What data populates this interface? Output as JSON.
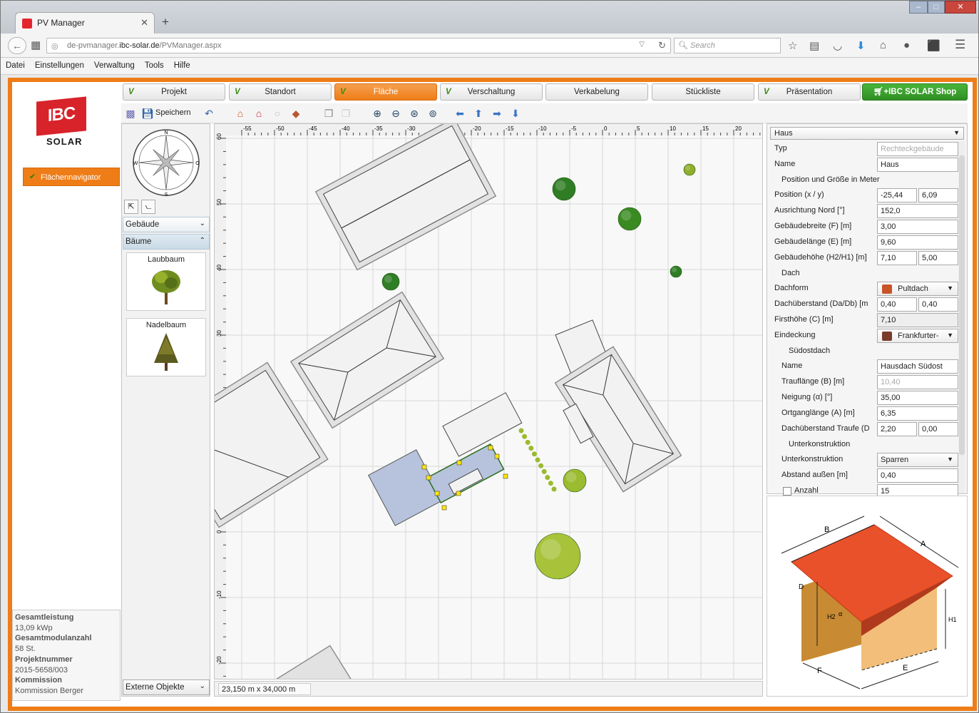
{
  "browser": {
    "tab_title": "PV Manager",
    "url_prefix": "de-pvmanager.",
    "url_domain": "ibc-solar.de",
    "url_path": "/PVManager.aspx",
    "search_placeholder": "Search"
  },
  "menu": [
    "Datei",
    "Einstellungen",
    "Verwaltung",
    "Tools",
    "Hilfe"
  ],
  "logo": {
    "top": "IBC",
    "bottom": "SOLAR"
  },
  "sidebar": {
    "navigator_label": "Flächennavigator"
  },
  "summary": {
    "total_power_label": "Gesamtleistung",
    "total_power_value": "13,09  kWp",
    "module_count_label": "Gesamtmodulanzahl",
    "module_count_value": "58  St.",
    "project_number_label": "Projektnummer",
    "project_number_value": "2015-5658/003",
    "commission_label": "Kommission",
    "commission_value": "Kommission Berger"
  },
  "tabs": [
    {
      "label": "Projekt",
      "checked": true
    },
    {
      "label": "Standort",
      "checked": true
    },
    {
      "label": "Fläche",
      "checked": true,
      "active": true
    },
    {
      "label": "Verschaltung",
      "checked": true
    },
    {
      "label": "Verkabelung",
      "checked": false
    },
    {
      "label": "Stückliste",
      "checked": false
    },
    {
      "label": "Präsentation",
      "checked": true
    }
  ],
  "shop_label": "IBC SOLAR Shop",
  "toolbar": {
    "save_label": "Speichern"
  },
  "palette": {
    "compass": {
      "n": "N",
      "s": "S",
      "e": "O",
      "w": "W"
    },
    "group_buildings": "Gebäude",
    "group_trees": "Bäume",
    "tree1": "Laubbaum",
    "tree2": "Nadelbaum",
    "external_objects": "Externe Objekte"
  },
  "canvas": {
    "x_ticks": [
      "-55",
      "-50",
      "-45",
      "-40",
      "-35",
      "-30",
      "-25",
      "-20",
      "-15",
      "-10",
      "-5",
      "0",
      "5",
      "10",
      "15",
      "20"
    ],
    "y_ticks": [
      "60",
      "50",
      "40",
      "30",
      "20",
      "10",
      "0",
      "-10",
      "-20"
    ],
    "dimensions": "23,150 m x 34,000 m"
  },
  "properties": {
    "object": "Haus",
    "rows": [
      {
        "label": "Typ",
        "v1": "Rechteckgebäude",
        "kind": "full",
        "disabled": true
      },
      {
        "label": "Name",
        "v1": "Haus",
        "kind": "full"
      },
      {
        "label": "Position und Größe in Meter",
        "kind": "section"
      },
      {
        "label": "Position (x / y)",
        "v1": "-25,44",
        "v2": "6,09",
        "kind": "half"
      },
      {
        "label": "Ausrichtung Nord [°]",
        "v1": "152,0",
        "kind": "full"
      },
      {
        "label": "Gebäudebreite (F) [m]",
        "v1": "3,00",
        "kind": "full"
      },
      {
        "label": "Gebäudelänge (E) [m]",
        "v1": "9,60",
        "kind": "full"
      },
      {
        "label": "Gebäudehöhe (H2/H1) [m]",
        "v1": "7,10",
        "v2": "5,00",
        "kind": "half"
      },
      {
        "label": "Dach",
        "kind": "section"
      },
      {
        "label": "Dachform",
        "v1": "Pultdach",
        "kind": "select"
      },
      {
        "label": "Dachüberstand (Da/Db) [m",
        "v1": "0,40",
        "v2": "0,40",
        "kind": "half"
      },
      {
        "label": "Firsthöhe (C) [m]",
        "v1": "7,10",
        "kind": "full",
        "grey": true
      },
      {
        "label": "Eindeckung",
        "v1": "Frankfurter-",
        "kind": "select"
      },
      {
        "label": "Südostdach",
        "kind": "section",
        "indent": true
      },
      {
        "label": "Name",
        "v1": "Hausdach Südost",
        "kind": "full",
        "indent": true
      },
      {
        "label": "Trauflänge (B) [m]",
        "v1": "10,40",
        "kind": "full",
        "indent": true,
        "disabled": true
      },
      {
        "label": "Neigung (α) [°]",
        "v1": "35,00",
        "kind": "full",
        "indent": true
      },
      {
        "label": "Ortganglänge (A) [m]",
        "v1": "6,35",
        "kind": "full",
        "indent": true
      },
      {
        "label": "Dachüberstand Traufe (D",
        "v1": "2,20",
        "v2": "0,00",
        "kind": "half",
        "indent": true
      },
      {
        "label": "Unterkonstruktion",
        "kind": "section",
        "indent": true
      },
      {
        "label": "Unterkonstruktion",
        "v1": "Sparren",
        "kind": "select",
        "indent": true
      },
      {
        "label": "Abstand außen [m]",
        "v1": "0,40",
        "kind": "full",
        "indent": true
      },
      {
        "label": "Anzahl",
        "v1": "15",
        "kind": "full",
        "indent": true,
        "checkbox": true
      }
    ]
  },
  "house_diagram": {
    "labels": [
      "B",
      "A",
      "D",
      "H2",
      "α",
      "H1",
      "F",
      "E"
    ]
  }
}
